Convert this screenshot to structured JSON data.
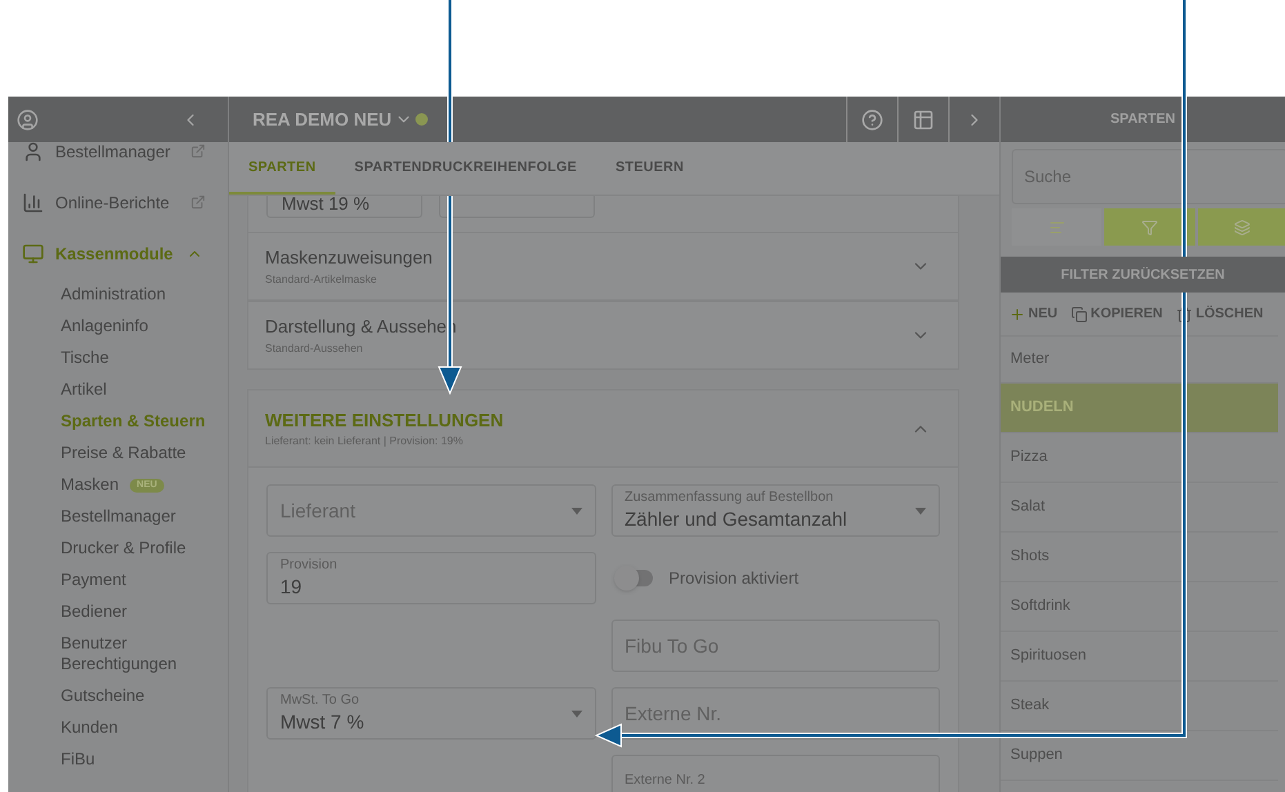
{
  "header": {
    "title": "REA DEMO NEU"
  },
  "sidebar": {
    "items": [
      {
        "label": "Bestellmanager",
        "kind": "external"
      },
      {
        "label": "Online-Berichte",
        "kind": "external"
      },
      {
        "label": "Kassenmodule",
        "kind": "group",
        "expanded": true,
        "children": [
          {
            "label": "Administration",
            "selected": false
          },
          {
            "label": "Anlageninfo",
            "selected": false
          },
          {
            "label": "Tische",
            "selected": false
          },
          {
            "label": "Artikel",
            "selected": false
          },
          {
            "label": "Sparten & Steuern",
            "selected": true
          },
          {
            "label": "Preise & Rabatte",
            "selected": false
          },
          {
            "label": "Masken",
            "selected": false,
            "badge": "NEU"
          },
          {
            "label": "Bestellmanager",
            "selected": false
          },
          {
            "label": "Drucker & Profile",
            "selected": false
          },
          {
            "label": "Payment",
            "selected": false
          },
          {
            "label": "Bediener",
            "selected": false
          },
          {
            "label": "Benutzer Berechtigungen",
            "selected": false
          },
          {
            "label": "Gutscheine",
            "selected": false
          },
          {
            "label": "Kunden",
            "selected": false
          },
          {
            "label": "FiBu",
            "selected": false
          }
        ]
      }
    ]
  },
  "tabs": [
    {
      "label": "SPARTEN",
      "selected": true
    },
    {
      "label": "SPARTENDRUCKREIHENFOLGE",
      "selected": false
    },
    {
      "label": "STEUERN",
      "selected": false
    }
  ],
  "partial_field": {
    "value": "Mwst 19 %"
  },
  "sections": [
    {
      "title": "Maskenzuweisungen",
      "subtitle": "Standard-Artikelmaske",
      "expanded": false
    },
    {
      "title": "Darstellung & Aussehen",
      "subtitle": "Standard-Aussehen",
      "expanded": false
    },
    {
      "title": "WEITERE EINSTELLUNGEN",
      "subtitle": "Lieferant: kein Lieferant | Provision: 19%",
      "expanded": true
    }
  ],
  "fields": [
    {
      "kind": "select",
      "placeholder": "Lieferant"
    },
    {
      "kind": "select",
      "label": "Zusammenfassung auf Bestellbon",
      "value": "Zähler und Gesamtanzahl"
    },
    {
      "kind": "text",
      "label": "Provision",
      "value": "19"
    },
    {
      "kind": "toggle",
      "label": "Provision aktiviert",
      "on": false
    },
    {
      "kind": "empty"
    },
    {
      "kind": "text",
      "placeholder": "Fibu To Go"
    },
    {
      "kind": "select",
      "label": "MwSt. To Go",
      "value": "Mwst 7 %"
    },
    {
      "kind": "text",
      "placeholder": "Externe Nr."
    },
    {
      "kind": "empty"
    },
    {
      "kind": "text",
      "label": "Externe Nr. 2"
    }
  ],
  "panel": {
    "title": "SPARTEN",
    "search": {
      "placeholder": "Suche"
    },
    "view_buttons": [
      {
        "kind": "sort",
        "active": false
      },
      {
        "kind": "filter",
        "active": true
      },
      {
        "kind": "layers",
        "active": true
      }
    ],
    "reset": "FILTER ZURÜCKSETZEN",
    "actions": [
      {
        "kind": "add",
        "label": "NEU"
      },
      {
        "kind": "copy",
        "label": "KOPIEREN"
      },
      {
        "kind": "delete",
        "label": "LÖSCHEN"
      }
    ],
    "items": [
      {
        "label": "Meter",
        "selected": false
      },
      {
        "label": "NUDELN",
        "selected": true
      },
      {
        "label": "Pizza",
        "selected": false
      },
      {
        "label": "Salat",
        "selected": false
      },
      {
        "label": "Shots",
        "selected": false
      },
      {
        "label": "Softdrink",
        "selected": false
      },
      {
        "label": "Spirituosen",
        "selected": false
      },
      {
        "label": "Steak",
        "selected": false
      },
      {
        "label": "Suppen",
        "selected": false
      }
    ]
  }
}
